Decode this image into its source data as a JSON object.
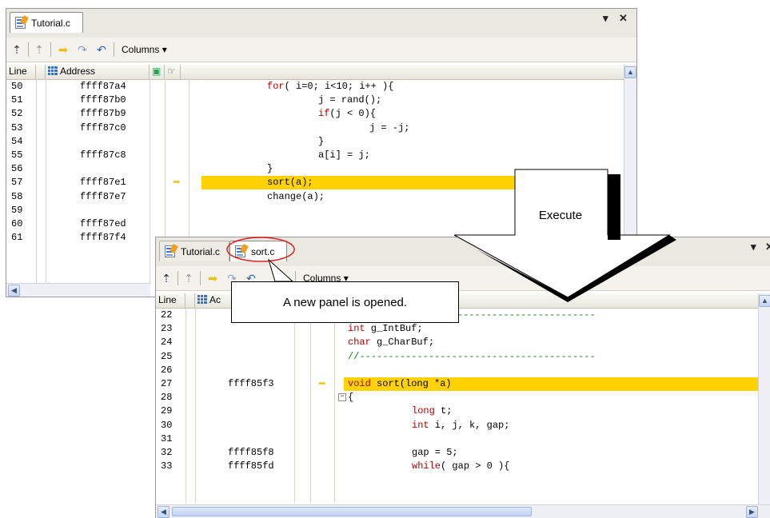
{
  "panel1": {
    "tab_label": "Tutorial.c",
    "toolbar": {
      "columns_label": "Columns"
    },
    "header": {
      "line": "Line",
      "address": "Address"
    },
    "rows": [
      {
        "line": "50",
        "addr": "ffff87a4",
        "code": "for( i=0; i<10; i++ ){",
        "indent": 0,
        "kw": "for"
      },
      {
        "line": "51",
        "addr": "ffff87b0",
        "code": "j = rand();",
        "indent": 1
      },
      {
        "line": "52",
        "addr": "ffff87b9",
        "code": "if(j < 0){",
        "indent": 1,
        "kw": "if"
      },
      {
        "line": "53",
        "addr": "ffff87c0",
        "code": "j = -j;",
        "indent": 2
      },
      {
        "line": "54",
        "addr": "",
        "code": "}",
        "indent": 1
      },
      {
        "line": "55",
        "addr": "ffff87c8",
        "code": "a[i] = j;",
        "indent": 1
      },
      {
        "line": "56",
        "addr": "",
        "code": "}",
        "indent": 0
      },
      {
        "line": "57",
        "addr": "ffff87e1",
        "code": "sort(a);",
        "indent": 0,
        "current": true
      },
      {
        "line": "58",
        "addr": "ffff87e7",
        "code": "change(a);",
        "indent": 0
      },
      {
        "line": "59",
        "addr": "",
        "code": "",
        "indent": 0
      },
      {
        "line": "60",
        "addr": "ffff87ed",
        "code": "",
        "indent": 0
      },
      {
        "line": "61",
        "addr": "ffff87f4",
        "code": "",
        "indent": 0
      }
    ]
  },
  "panel2": {
    "tabs": [
      "Tutorial.c",
      "sort.c"
    ],
    "active_tab": "sort.c",
    "toolbar": {
      "columns_label": "Columns"
    },
    "header": {
      "line": "Line",
      "address": "Ac"
    },
    "rows": [
      {
        "line": "22",
        "addr": "",
        "code": "",
        "cm": "//-----------------------------------------"
      },
      {
        "line": "23",
        "addr": "",
        "code": "int g_IntBuf;",
        "kw": "int"
      },
      {
        "line": "24",
        "addr": "",
        "code": "char g_CharBuf;",
        "kw": "char"
      },
      {
        "line": "25",
        "addr": "",
        "code": "",
        "cm": "//-----------------------------------------"
      },
      {
        "line": "26",
        "addr": "",
        "code": ""
      },
      {
        "line": "27",
        "addr": "ffff85f3",
        "code": "void sort(long *a)",
        "current": true
      },
      {
        "line": "28",
        "addr": "",
        "code": "{",
        "fold": true
      },
      {
        "line": "29",
        "addr": "",
        "code": "long t;",
        "indent": 1,
        "kw": "long"
      },
      {
        "line": "30",
        "addr": "",
        "code": "int i, j, k, gap;",
        "indent": 1,
        "kw": "int"
      },
      {
        "line": "31",
        "addr": "",
        "code": ""
      },
      {
        "line": "32",
        "addr": "ffff85f8",
        "code": "gap = 5;",
        "indent": 1
      },
      {
        "line": "33",
        "addr": "ffff85fd",
        "code": "while( gap > 0 ){",
        "indent": 1,
        "kw": "while"
      }
    ]
  },
  "annotations": {
    "execute_label": "Execute",
    "new_panel_label": "A new panel is opened."
  },
  "colors": {
    "highlight": "#ffd200",
    "keyword": "#b00000",
    "comment": "#108010",
    "callout_ring": "#e02020"
  }
}
